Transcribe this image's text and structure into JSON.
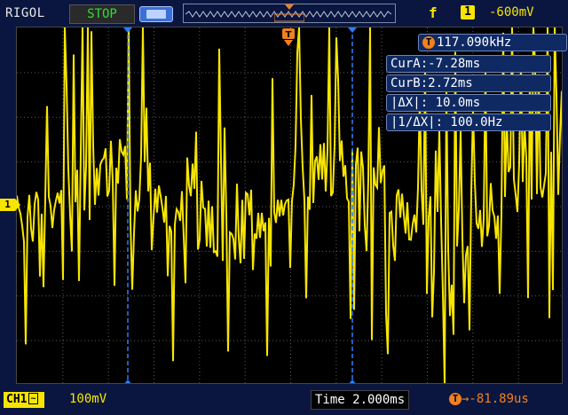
{
  "header": {
    "brand": "RIGOL",
    "run_state": "STOP",
    "trigger_edge_symbol": "f",
    "trigger_channel": "1",
    "trigger_level": "-600mV"
  },
  "measurements": {
    "frequency_icon": "T",
    "frequency": "117.090kHz",
    "cursor_a": "CurA:-7.28ms",
    "cursor_b": "CurB:2.72ms",
    "delta_x": "|ΔX|: 10.0ms",
    "inverse_delta_x": "|1/ΔX|: 100.0Hz"
  },
  "channel": {
    "marker_label": "1",
    "badge_label": "CH1",
    "coupling_symbol": "~",
    "scale": "100mV"
  },
  "timebase": {
    "label": "Time 2.000ms",
    "position_icon": "T",
    "position": "→-81.89us"
  },
  "colors": {
    "trace": "#f7e500",
    "cursor": "#2a7fff",
    "trigger": "#f08020",
    "background": "#000000",
    "frame": "#0a1640"
  },
  "icons": {
    "battery": "battery-icon",
    "trigger_edge": "rising-edge-icon",
    "trigger_position": "trigger-position-icon"
  }
}
